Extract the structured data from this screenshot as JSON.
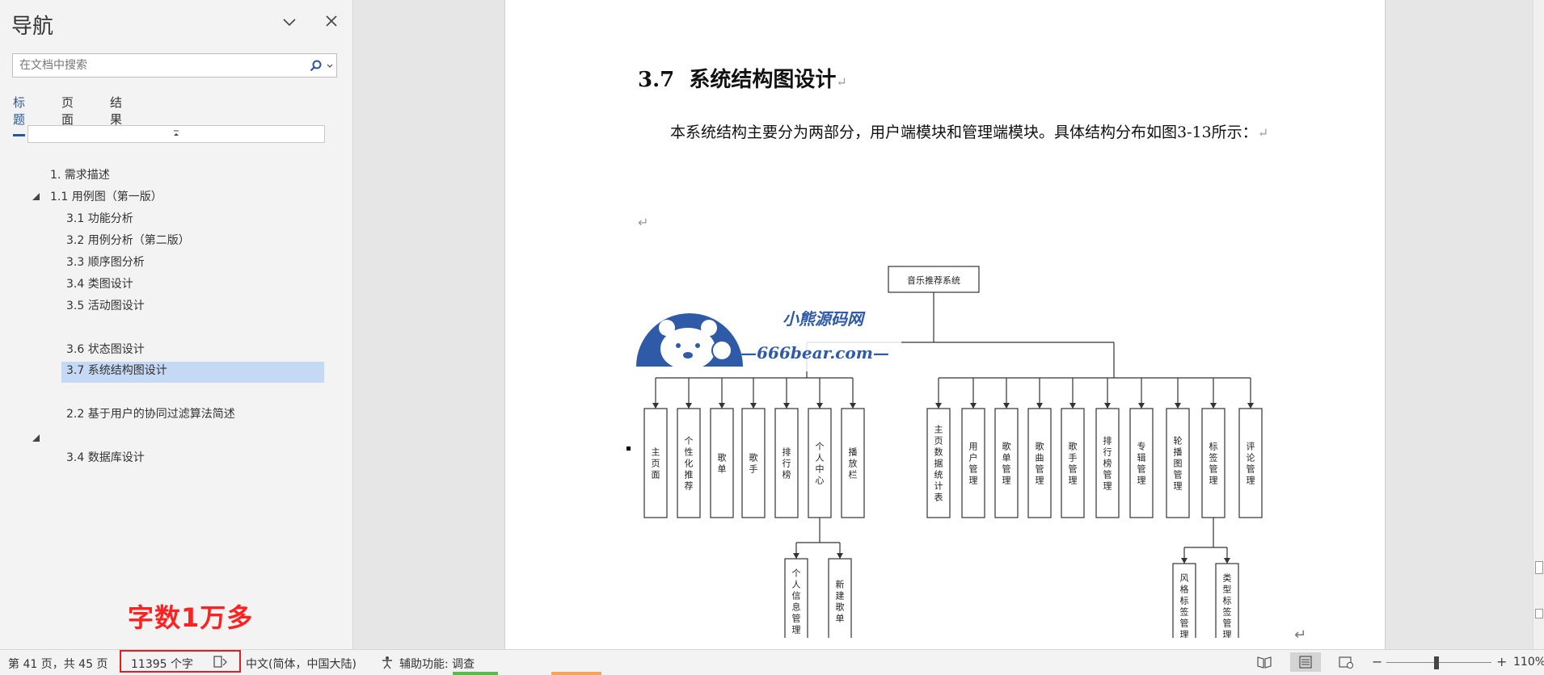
{
  "nav": {
    "title": "导航",
    "search_placeholder": "在文档中搜索",
    "tabs": [
      "标题",
      "页面",
      "结果"
    ],
    "items": [
      {
        "label": "1. 需求描述",
        "level": 1
      },
      {
        "label": "1.1 用例图（第一版）",
        "level": 1,
        "expanded": true
      },
      {
        "label": "3.1 功能分析",
        "level": 2
      },
      {
        "label": "3.2 用例分析（第二版）",
        "level": 2
      },
      {
        "label": "3.3 顺序图分析",
        "level": 2
      },
      {
        "label": "3.4 类图设计",
        "level": 2
      },
      {
        "label": "3.5 活动图设计",
        "level": 2
      },
      {
        "label": "3.6 状态图设计",
        "level": 2
      },
      {
        "label": "3.7 系统结构图设计",
        "level": 2,
        "selected": true
      },
      {
        "label": "2.2 基于用户的协同过滤算法简述",
        "level": 2
      },
      {
        "label": "3.4 数据库设计",
        "level": 2
      }
    ]
  },
  "overlay": {
    "word_note": "字数1万多",
    "logo_title": "小熊源码网",
    "logo_url": "—666bear.com—"
  },
  "document": {
    "heading_number": "3.7",
    "heading_text": "系统结构图设计",
    "paragraph": "本系统结构主要分为两部分，用户端模块和管理端模块。具体结构分布如图3-13所示：",
    "diagram": {
      "root": "音乐推荐系统",
      "user_modules": [
        "主页面",
        "个性化推荐",
        "歌单",
        "歌手",
        "排行榜",
        "个人中心",
        "播放栏"
      ],
      "user_center_children": [
        "个人信息管理",
        "新建歌单"
      ],
      "admin_modules": [
        "主页数据统计表",
        "用户管理",
        "歌单管理",
        "歌曲管理",
        "歌手管理",
        "排行榜管理",
        "专辑管理",
        "轮播图管理",
        "标签管理",
        "评论管理"
      ],
      "tag_children": [
        "风格标签管理",
        "类型标签管理"
      ]
    }
  },
  "status": {
    "page_info": "第 41 页，共 45 页",
    "word_count": "11395 个字",
    "language": "中文(简体，中国大陆)",
    "accessibility": "辅助功能: 调查",
    "zoom": "110%"
  },
  "colors": {
    "accent": "#2b579a",
    "selected_bg": "#c5d9f4",
    "highlight_red": "#e02020",
    "logo_blue": "#2f5aa8"
  }
}
